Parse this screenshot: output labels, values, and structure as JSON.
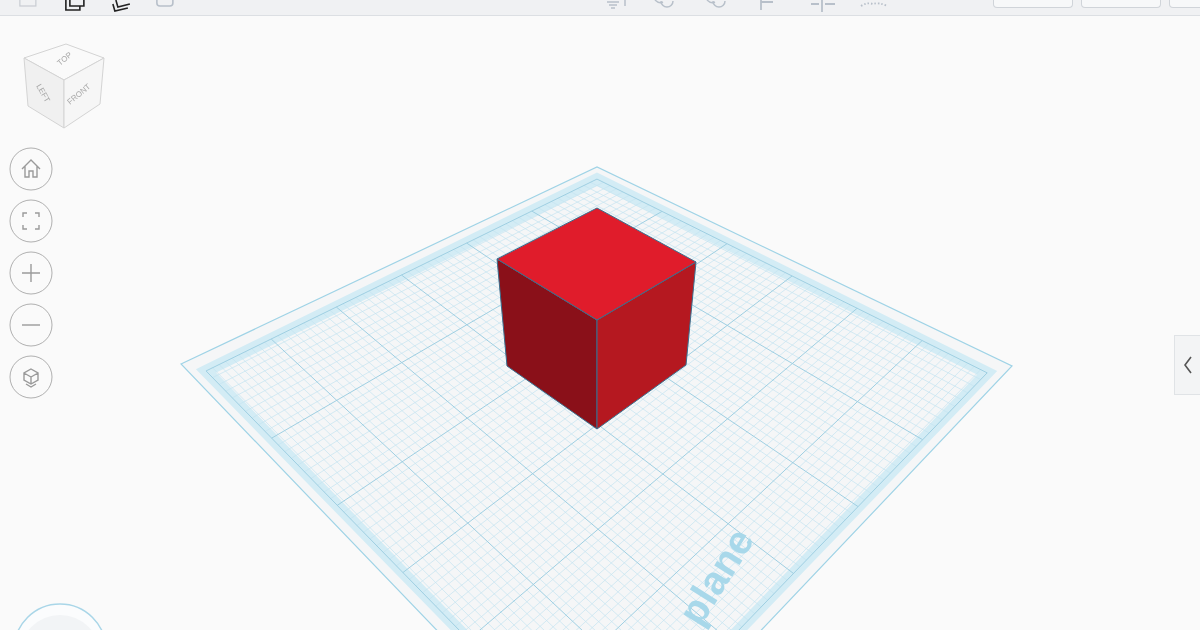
{
  "toolbar": {
    "left_tools": [
      {
        "kind": "box"
      },
      {
        "kind": "copy"
      },
      {
        "kind": "paste"
      },
      {
        "kind": "trash"
      }
    ],
    "right_tools": [
      {
        "kind": "light"
      },
      {
        "kind": "undo"
      },
      {
        "kind": "redo"
      },
      {
        "kind": "align"
      },
      {
        "kind": "mirror"
      },
      {
        "kind": "group"
      }
    ],
    "buttons": [
      {
        "kind": "plain"
      },
      {
        "kind": "plain"
      },
      {
        "kind": "plain"
      }
    ]
  },
  "view_cube": {
    "top": "TOP",
    "left": "LEFT",
    "front": "FRONT"
  },
  "nav_buttons": [
    {
      "kind": "home"
    },
    {
      "kind": "fit"
    },
    {
      "kind": "zoom_in"
    },
    {
      "kind": "zoom_out"
    },
    {
      "kind": "ortho"
    }
  ],
  "workplane": {
    "label": "plane"
  }
}
